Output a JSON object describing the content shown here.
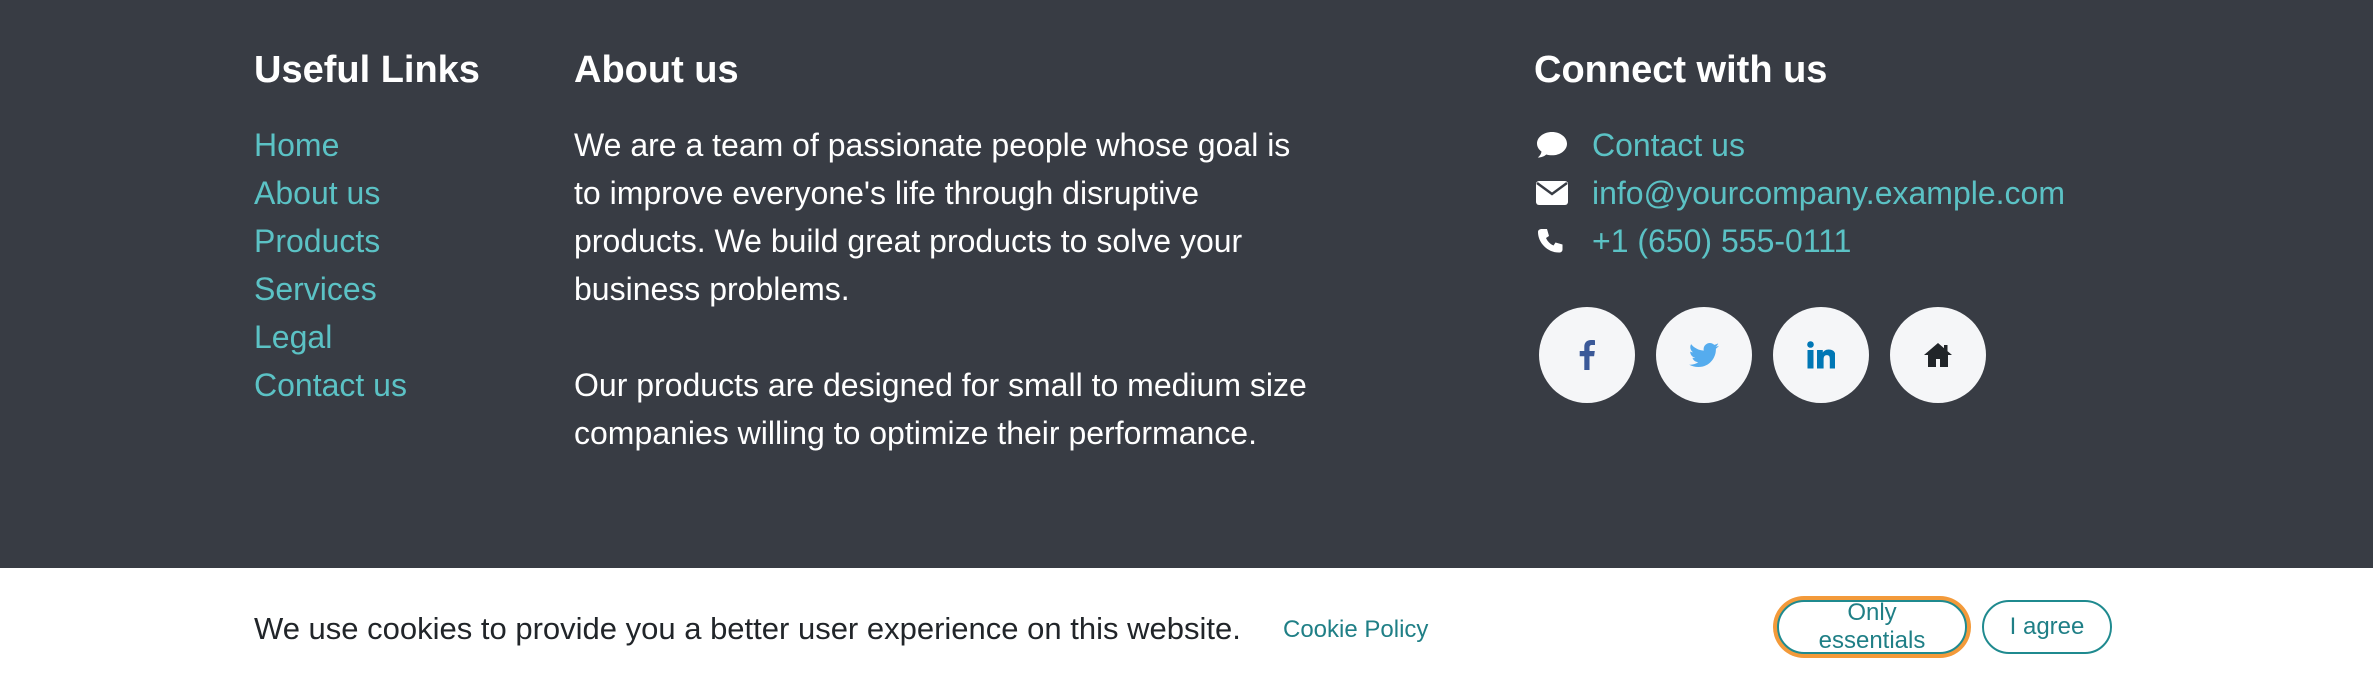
{
  "useful_links": {
    "title": "Useful Links",
    "items": [
      {
        "label": "Home"
      },
      {
        "label": "About us"
      },
      {
        "label": "Products"
      },
      {
        "label": "Services"
      },
      {
        "label": "Legal"
      },
      {
        "label": "Contact us"
      }
    ]
  },
  "about": {
    "title": "About us",
    "paragraph1": "We are a team of passionate people whose goal is to improve everyone's life through disruptive products. We build great products to solve your business problems.",
    "paragraph2": "Our products are designed for small to medium size companies willing to optimize their performance."
  },
  "connect": {
    "title": "Connect with us",
    "contact_label": "Contact us",
    "email": "info@yourcompany.example.com",
    "phone": "+1 (650) 555-0111",
    "icons": [
      "comment-icon",
      "envelope-icon",
      "phone-icon"
    ],
    "socials": [
      "facebook-icon",
      "twitter-icon",
      "linkedin-icon",
      "home-icon"
    ]
  },
  "cookie_bar": {
    "message": "We use cookies to provide you a better user experience on this website.",
    "policy_link": "Cookie Policy",
    "essentials_button": "Only essentials",
    "agree_button": "I agree"
  },
  "colors": {
    "footer_bg": "#383c44",
    "link": "#5bc2c5",
    "button_border": "#1f8a8f",
    "focus_ring": "#f39a3a"
  }
}
